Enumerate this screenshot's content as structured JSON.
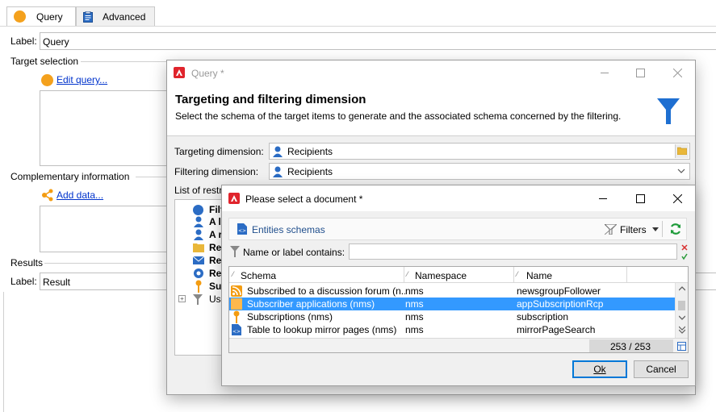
{
  "tabs": {
    "query_label": "Query",
    "advanced_label": "Advanced"
  },
  "main": {
    "label_caption": "Label:",
    "label_value": "Query",
    "target_selection": "Target selection",
    "edit_query": "Edit query...",
    "complementary": "Complementary information",
    "add_data": "Add data...",
    "results": "Results",
    "result_label_caption": "Label:",
    "result_value": "Result"
  },
  "query_dialog": {
    "title": "Query *",
    "heading": "Targeting and filtering dimension",
    "description": "Select the schema of the target items to  generate and the associated schema concerned by the filtering.",
    "targeting_caption": "Targeting dimension:",
    "targeting_value": "Recipients",
    "filtering_caption": "Filtering dimension:",
    "filtering_value": "Recipients",
    "list_caption": "List of restr",
    "list_items": [
      "Filt",
      "A l",
      "A r",
      "Re",
      "Re",
      "Re",
      "Sul",
      "Use"
    ]
  },
  "select_dialog": {
    "title": "Please select a document *",
    "entities_schemas": "Entities schemas",
    "filters_label": "Filters",
    "name_caption": "Name or label contains:",
    "name_value": "",
    "columns": [
      "Schema",
      "Namespace",
      "Name"
    ],
    "rows": [
      {
        "schema": "Subscribed to a discussion forum (n...",
        "namespace": "nms",
        "name": "newsgroupFollower",
        "icon": "rss-icon"
      },
      {
        "schema": "Subscriber applications (nms)",
        "namespace": "nms",
        "name": "appSubscriptionRcp",
        "icon": "subscriber-app-icon"
      },
      {
        "schema": "Subscriptions (nms)",
        "namespace": "nms",
        "name": "subscription",
        "icon": "subscription-icon"
      },
      {
        "schema": "Table to lookup mirror pages (nms)",
        "namespace": "nms",
        "name": "mirrorPageSearch",
        "icon": "table-icon"
      }
    ],
    "selected_index": 1,
    "count": "253 / 253",
    "ok_label": "Ok",
    "cancel_label": "Cancel"
  },
  "colors": {
    "selection": "#3399ff",
    "accent_blue": "#1f6fc4",
    "orange": "#f4a11d",
    "adobe_red": "#e0242c",
    "funnel_blue": "#1e6fd1"
  }
}
